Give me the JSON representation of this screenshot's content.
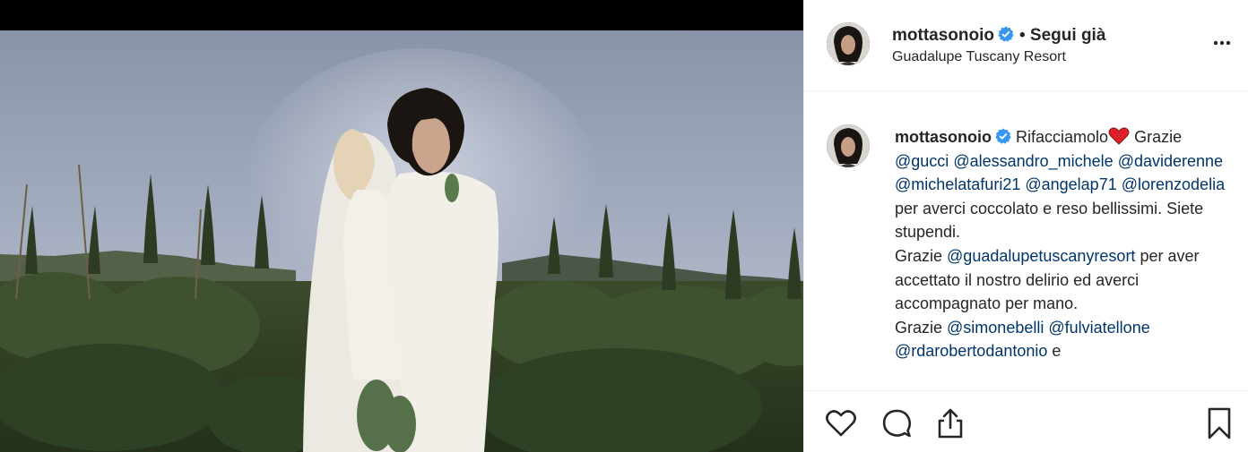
{
  "post": {
    "username": "mottasonoio",
    "follow_status": "• Segui già",
    "location": "Guadalupe Tuscany Resort"
  },
  "caption": {
    "username": "mottasonoio",
    "text_start": "Rifacciamolo",
    "thanks_1": "Grazie",
    "mentions_1": [
      "@gucci",
      "@alessandro_michele",
      "@daviderenne",
      "@michelatafuri21",
      "@angelap71",
      "@lorenzodelia"
    ],
    "text_after_mentions_1": "per averci coccolato e reso bellissimi. Siete stupendi.",
    "thanks_2": "Grazie",
    "mention_resort": "@guadalupetuscanyresort",
    "text_after_resort": "per aver accettato il nostro delirio ed averci accompagnato per mano.",
    "thanks_3": "Grazie",
    "mentions_3": [
      "@simonebelli",
      "@fulviatellone",
      "@rdarobertodantonio"
    ],
    "text_tail": "e"
  },
  "icons": {
    "verified": "verified-badge-icon",
    "more": "more-options-icon",
    "heart_emoji": "red-heart-emoji",
    "like": "heart-outline-icon",
    "comment": "comment-bubble-icon",
    "share": "share-upload-icon",
    "save": "bookmark-icon"
  },
  "colors": {
    "mention": "#003569",
    "verified": "#3897f0",
    "text": "#262626",
    "divider": "#efefef"
  }
}
